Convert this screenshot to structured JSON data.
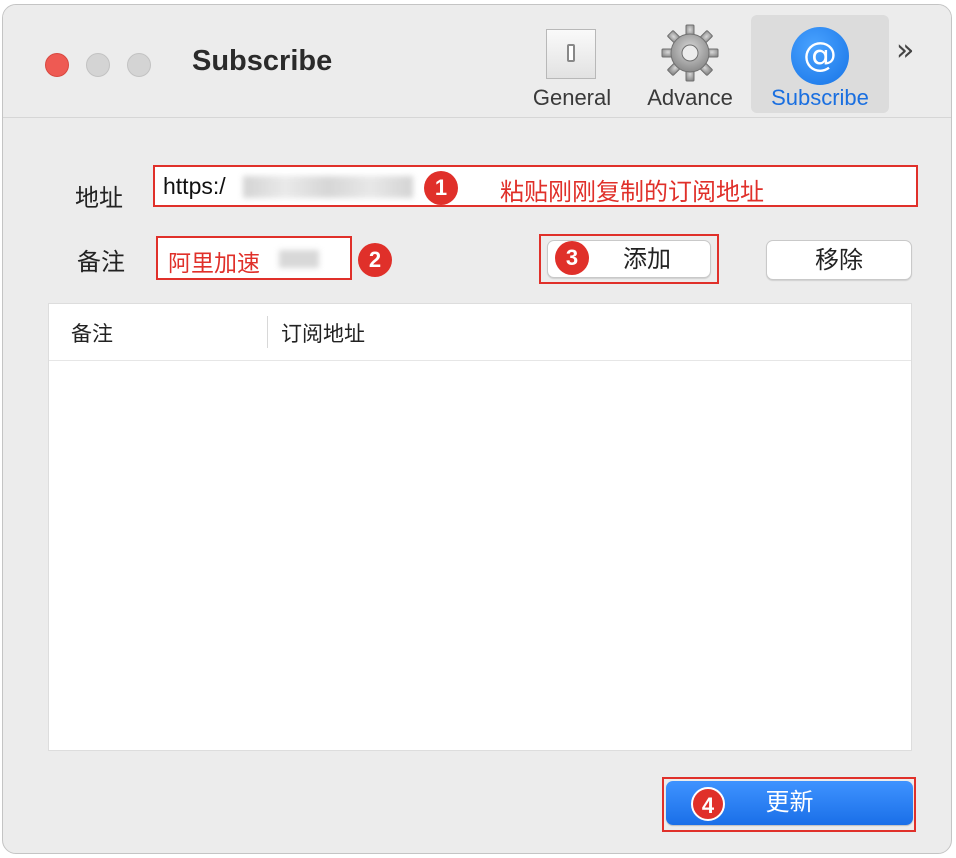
{
  "window": {
    "title": "Subscribe"
  },
  "toolbar": {
    "tabs": [
      {
        "label": "General",
        "icon": "switch-icon",
        "selected": false
      },
      {
        "label": "Advance",
        "icon": "gear-icon",
        "selected": false
      },
      {
        "label": "Subscribe",
        "icon": "at-icon",
        "selected": true
      }
    ],
    "at_symbol": "@",
    "overflow_glyph": "»",
    "accent_color": "#1a6fe0"
  },
  "form": {
    "address_label": "地址",
    "address_value": "https:/",
    "remark_label": "备注",
    "remark_value": "阿里加速",
    "add_button": "添加",
    "remove_button": "移除"
  },
  "annotations": {
    "color": "#e0302a",
    "badge_1": "1",
    "badge_2": "2",
    "badge_3": "3",
    "badge_4": "4",
    "note_1": "粘贴刚刚复制的订阅地址"
  },
  "table": {
    "columns": [
      "备注",
      "订阅地址"
    ],
    "rows": []
  },
  "footer": {
    "update_button": "更新"
  }
}
